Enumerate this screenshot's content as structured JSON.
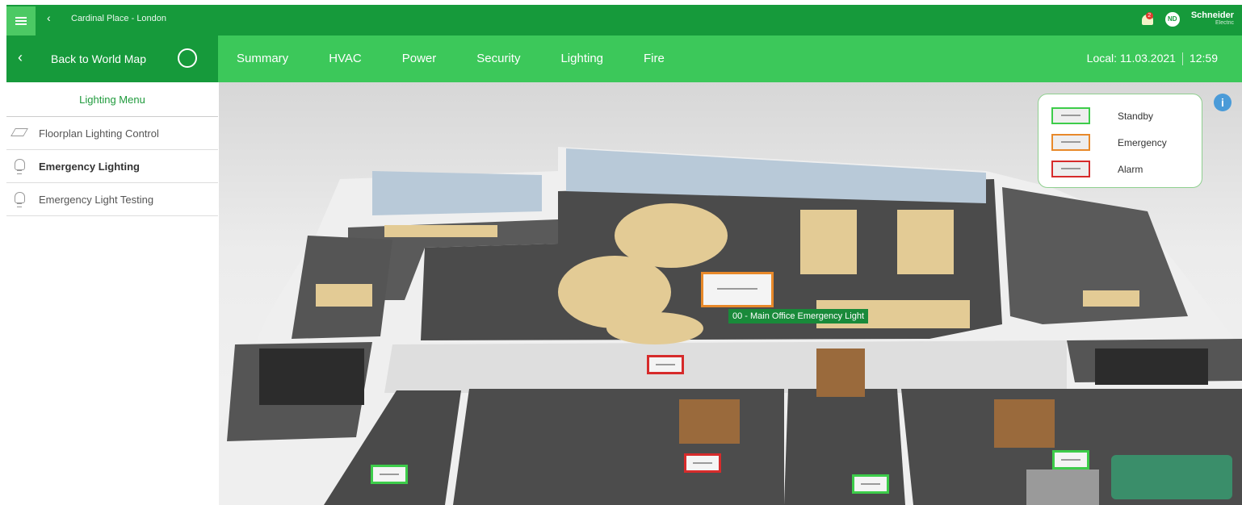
{
  "topbar": {
    "site_title": "Cardinal Place - London",
    "alarm_count": "2",
    "user_initials": "ND",
    "brand_name": "Schneider",
    "brand_sub": "Electric"
  },
  "nav": {
    "back_label": "Back to World Map",
    "tabs": [
      "Summary",
      "HVAC",
      "Power",
      "Security",
      "Lighting",
      "Fire"
    ],
    "local_label": "Local: 11.03.2021",
    "time": "12:59"
  },
  "sidebar": {
    "heading": "Lighting Menu",
    "items": [
      {
        "label": "Floorplan Lighting Control",
        "icon": "layers-icon"
      },
      {
        "label": "Emergency Lighting",
        "icon": "bulb-icon",
        "active": true
      },
      {
        "label": "Emergency Light Testing",
        "icon": "bulb-icon"
      }
    ]
  },
  "legend": {
    "items": [
      {
        "label": "Standby",
        "color": "#3dcc4a"
      },
      {
        "label": "Emergency",
        "color": "#e8892a"
      },
      {
        "label": "Alarm",
        "color": "#d62b2b"
      }
    ]
  },
  "floorplan": {
    "tooltip": "00 - Main Office Emergency Light"
  },
  "colors": {
    "primary_dark": "#169a3b",
    "primary": "#3cc85a"
  }
}
